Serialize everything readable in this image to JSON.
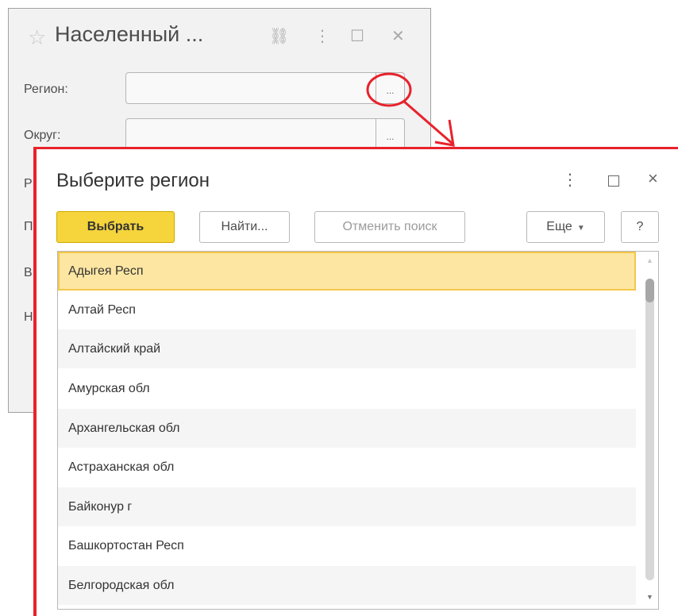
{
  "bg_form": {
    "title": "Населенный ...",
    "fields": [
      {
        "label": "Регион:",
        "dots": "..."
      },
      {
        "label": "Округ:",
        "dots": "..."
      }
    ],
    "cut_labels": [
      "Р",
      "П",
      "В",
      "Н"
    ]
  },
  "dialog": {
    "title": "Выберите регион",
    "toolbar": {
      "select_label": "Выбрать",
      "find_label": "Найти...",
      "cancel_search_label": "Отменить поиск",
      "more_label": "Еще",
      "help_label": "?"
    },
    "items": [
      "Адыгея Респ",
      "Алтай Респ",
      "Алтайский край",
      "Амурская обл",
      "Архангельская обл",
      "Астраханская обл",
      "Байконур г",
      "Башкортостан Респ",
      "Белгородская обл"
    ],
    "selected_index": 0
  },
  "colors": {
    "accent_yellow": "#f5d43c",
    "selection": "#fce6a2",
    "annotation_red": "#e8222c"
  }
}
